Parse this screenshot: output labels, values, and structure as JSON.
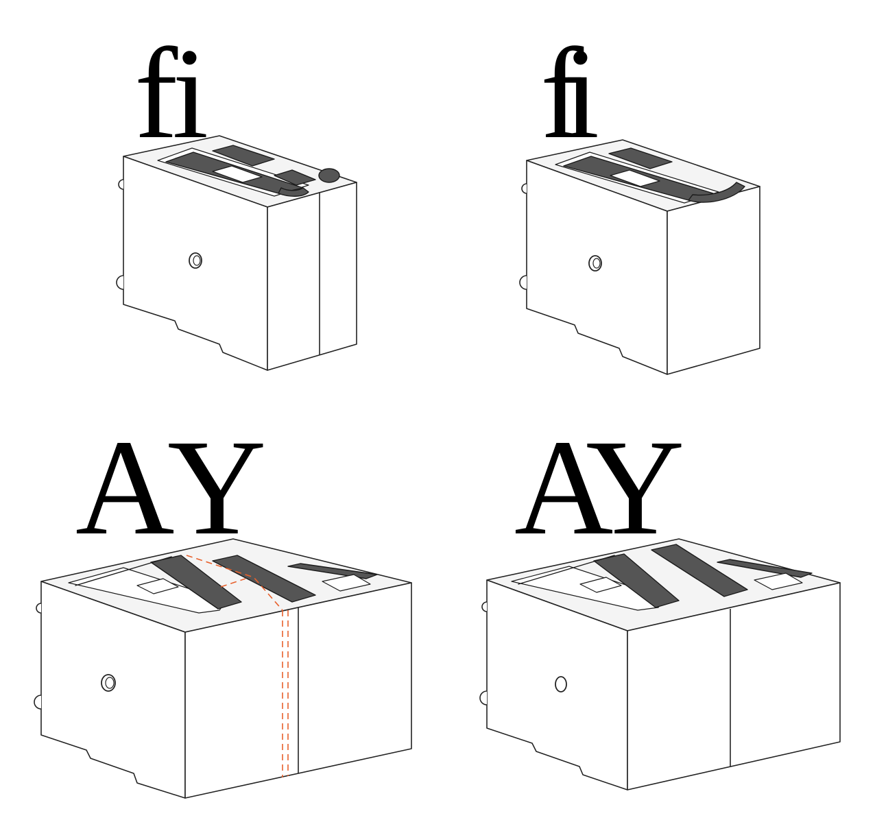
{
  "panels": [
    {
      "id": "top-left",
      "glyphs": "fi"
    },
    {
      "id": "top-right",
      "glyphs": "fi"
    },
    {
      "id": "bottom-left",
      "glyphs": "AY"
    },
    {
      "id": "bottom-right",
      "glyphs": "AY"
    }
  ],
  "colors": {
    "ink": "#000000",
    "relief": "#555555",
    "kern_cut_line": "#e8602c"
  }
}
